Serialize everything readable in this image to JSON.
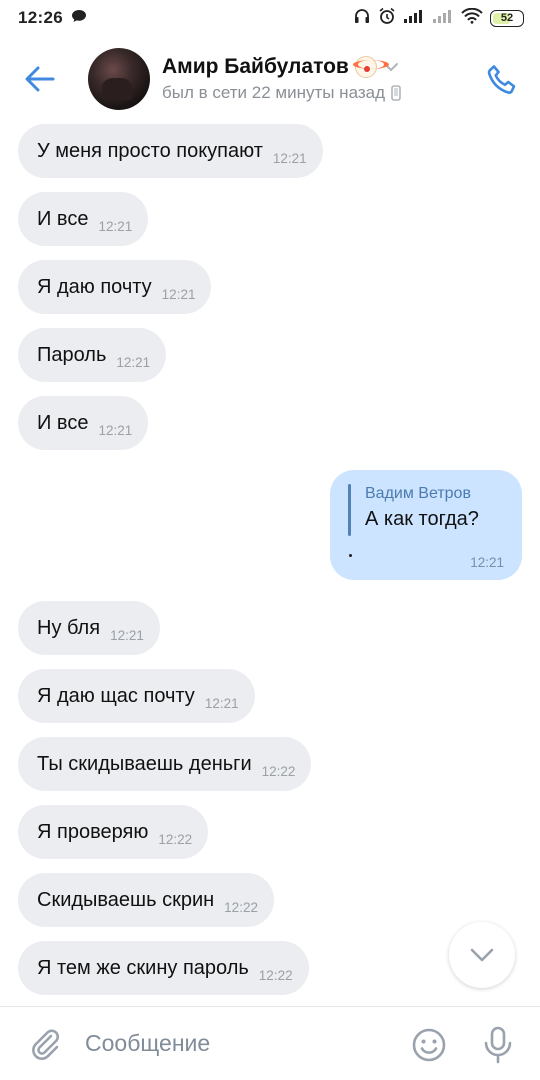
{
  "status_bar": {
    "time": "12:26",
    "battery": "52"
  },
  "header": {
    "peer_name": "Амир Байбулатов",
    "peer_status": "был в сети 22 минуты назад"
  },
  "messages": [
    {
      "text": "У меня просто покупают",
      "time": "12:21"
    },
    {
      "text": "И все",
      "time": "12:21"
    },
    {
      "text": "Я даю почту",
      "time": "12:21"
    },
    {
      "text": "Пароль",
      "time": "12:21"
    },
    {
      "text": "И все",
      "time": "12:21"
    }
  ],
  "outgoing": {
    "reply_author": "Вадим Ветров",
    "reply_text": "А как тогда?",
    "time": "12:21"
  },
  "messages2": [
    {
      "text": "Ну бля",
      "time": "12:21"
    },
    {
      "text": "Я даю щас почту",
      "time": "12:21"
    },
    {
      "text": "Ты скидываешь деньги",
      "time": "12:22"
    },
    {
      "text": "Я проверяю",
      "time": "12:22"
    },
    {
      "text": "Скидываешь скрин",
      "time": "12:22"
    },
    {
      "text": "Я тем же скину пароль",
      "time": "12:22"
    }
  ],
  "composer": {
    "placeholder": "Сообщение"
  },
  "colors": {
    "accent": "#3f8ae0",
    "incoming_bubble": "#ebedf0",
    "outgoing_bubble": "#cce4ff"
  }
}
